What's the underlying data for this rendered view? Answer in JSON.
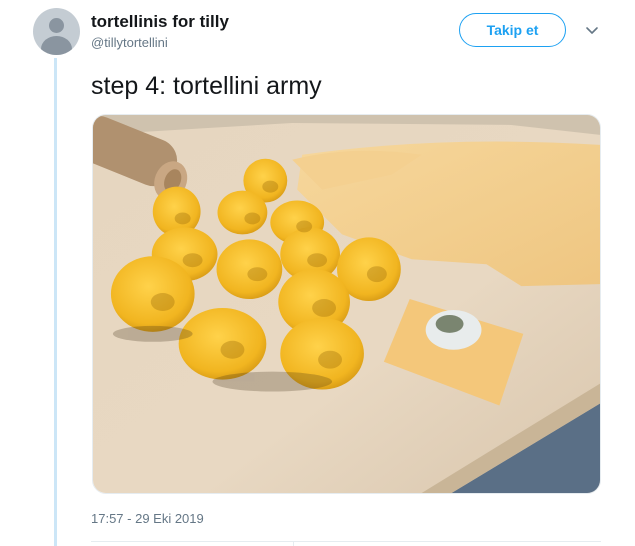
{
  "tweet": {
    "display_name": "tortellinis for tilly",
    "handle": "@tillytortellini",
    "follow_label": "Takip et",
    "text": "step 4: tortellini army",
    "timestamp": "17:57 - 29 Eki 2019",
    "photo_description_icon": "photo-of-tortellini",
    "accent_color": "#1da1f2"
  },
  "icons": {
    "avatar": "default-avatar-icon",
    "menu": "chevron-down-icon"
  }
}
